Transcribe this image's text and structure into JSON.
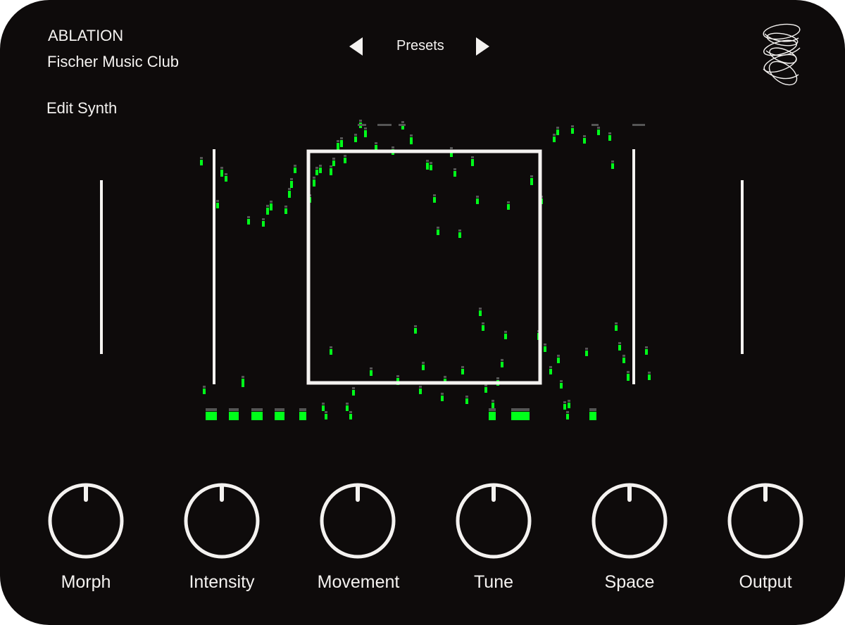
{
  "header": {
    "plugin_name": "ABLATION",
    "preset_name": "Fischer Music Club",
    "edit_label": "Edit Synth",
    "presets_label": "Presets"
  },
  "icons": {
    "prev": "triangle-left-icon",
    "next": "triangle-right-icon",
    "logo": "scribble-logo-icon"
  },
  "knobs": [
    {
      "label": "Morph",
      "value": 0.5
    },
    {
      "label": "Intensity",
      "value": 0.5
    },
    {
      "label": "Movement",
      "value": 0.5
    },
    {
      "label": "Tune",
      "value": 0.5
    },
    {
      "label": "Space",
      "value": 0.5
    },
    {
      "label": "Output",
      "value": 0.5
    }
  ],
  "colors": {
    "background": "#0e0b0b",
    "foreground": "#f4f2f0",
    "accent": "#00ff1a"
  }
}
